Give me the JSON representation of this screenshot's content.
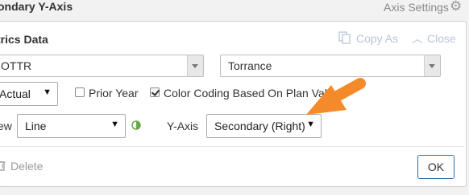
{
  "header": {
    "title": "ondary Y-Axis",
    "axis_settings_label": "Axis Settings"
  },
  "metrics": {
    "title": "trics Data",
    "copy_label": "Copy As",
    "close_label": "Close",
    "metric_select": "OTTR",
    "location_select": "Torrance",
    "type_select": "Actual",
    "prior_year": {
      "label": "Prior Year",
      "checked": false
    },
    "color_coding": {
      "label": "Color Coding Based On Plan Values",
      "checked": true
    },
    "view_label": "ew",
    "view_select": "Line",
    "yaxis_label": "Y-Axis",
    "yaxis_select": "Secondary (Right)",
    "delete_label": "Delete",
    "ok_label": "OK"
  },
  "colors": {
    "annotation_arrow": "#f58a2a",
    "ok_border": "#2e6da4",
    "link_muted": "#b8c6d6"
  },
  "icons": [
    "gear-icon",
    "copy-icon",
    "chevron-up-icon",
    "leaf-icon",
    "trash-icon",
    "annotation-arrow"
  ]
}
